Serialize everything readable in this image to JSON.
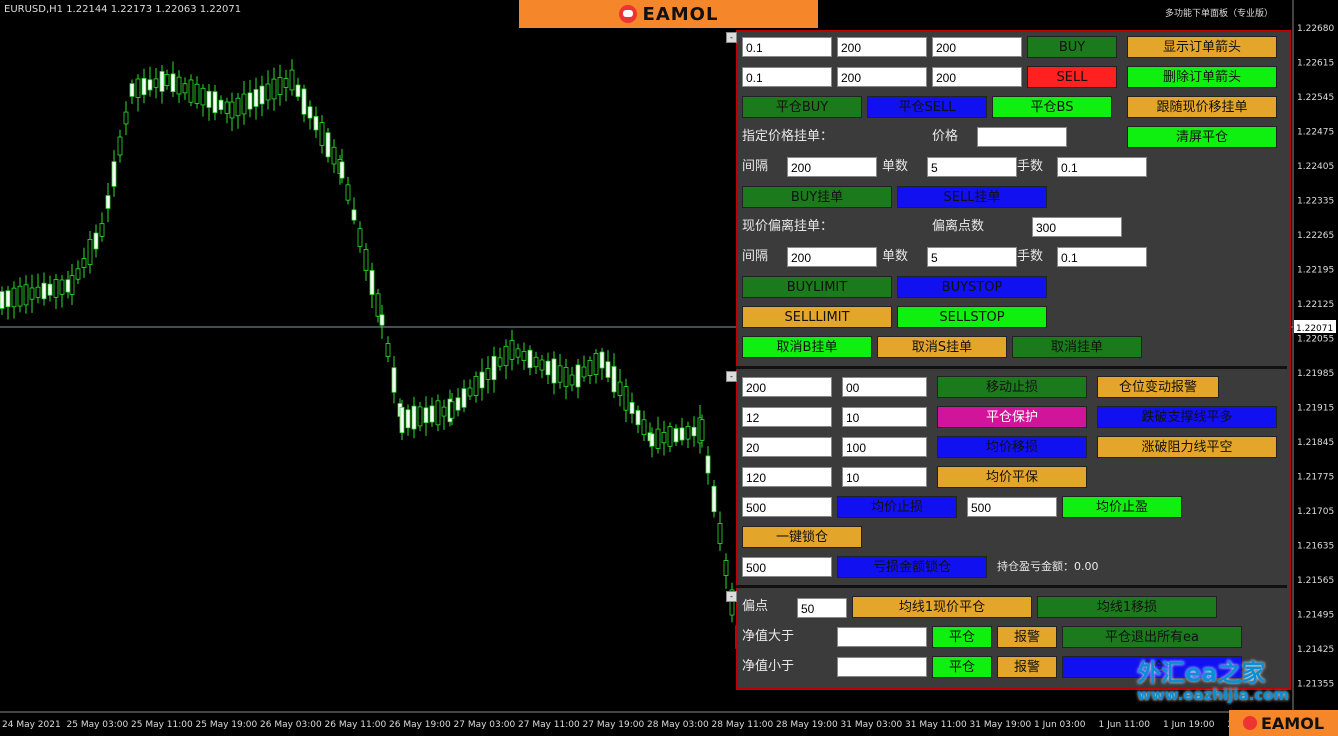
{
  "header": {
    "symbol_info": "EURUSD,H1  1.22144 1.22173 1.22063 1.22071",
    "top_right": "多功能下单面板（专业版）"
  },
  "brand": {
    "name": "EAMOL"
  },
  "price_axis": [
    "1.22680",
    "1.22615",
    "1.22545",
    "1.22475",
    "1.22405",
    "1.22335",
    "1.22265",
    "1.22195",
    "1.22125",
    "1.22071",
    "1.22055",
    "1.21985",
    "1.21915",
    "1.21845",
    "1.21775",
    "1.21705",
    "1.21635",
    "1.21565",
    "1.21495",
    "1.21425",
    "1.21355"
  ],
  "time_axis": [
    "24 May 2021",
    "25 May 03:00",
    "25 May 11:00",
    "25 May 19:00",
    "26 May 03:00",
    "26 May 11:00",
    "26 May 19:00",
    "27 May 03:00",
    "27 May 11:00",
    "27 May 19:00",
    "28 May 03:00",
    "28 May 11:00",
    "28 May 19:00",
    "31 May 03:00",
    "31 May 11:00",
    "31 May 19:00",
    "1 Jun 03:00",
    "1 Jun 11:00",
    "1 Jun 19:00",
    "2"
  ],
  "current_price": "1.22071",
  "panel": {
    "row1": {
      "lots": "0.1",
      "sl": "200",
      "tp": "200",
      "buy": "BUY",
      "show_arrows": "显示订单箭头"
    },
    "row2": {
      "lots": "0.1",
      "sl": "200",
      "tp": "200",
      "sell": "SELL",
      "delete_arrows": "删除订单箭头"
    },
    "row3": {
      "close_buy": "平仓BUY",
      "close_sell": "平仓SELL",
      "close_bs": "平仓BS",
      "follow_pending": "跟随现价移挂单"
    },
    "row4": {
      "label": "指定价格挂单：",
      "price_label": "价格",
      "price_value": "",
      "clear_close": "清屏平仓"
    },
    "row5": {
      "interval_label": "间隔",
      "interval": "200",
      "count_label": "单数",
      "count": "5",
      "lots_label": "手数",
      "lots": "0.1"
    },
    "row6": {
      "buy_pending": "BUY挂单",
      "sell_pending": "SELL挂单"
    },
    "row7": {
      "label": "现价偏离挂单：",
      "offset_label": "偏离点数",
      "offset": "300"
    },
    "row8": {
      "interval_label": "间隔",
      "interval": "200",
      "count_label": "单数",
      "count": "5",
      "lots_label": "手数",
      "lots": "0.1"
    },
    "row9": {
      "buylimit": "BUYLIMIT",
      "buystop": "BUYSTOP"
    },
    "row10": {
      "selllimit": "SELLLIMIT",
      "sellstop": "SELLSTOP"
    },
    "row11": {
      "cancel_b": "取消B挂单",
      "cancel_s": "取消S挂单",
      "cancel_all": "取消挂单"
    },
    "row12": {
      "v1": "200",
      "v2": "00",
      "move_sl": "移动止损",
      "alert": "仓位变动报警"
    },
    "row13": {
      "v1": "12",
      "v2": "10",
      "protect": "平仓保护",
      "break_support": "跌破支撑线平多"
    },
    "row14": {
      "v1": "20",
      "v2": "100",
      "avg_move": "均价移损",
      "break_resist": "涨破阻力线平空"
    },
    "row15": {
      "v1": "120",
      "v2": "10",
      "avg_be": "均价平保"
    },
    "row16": {
      "v1": "500",
      "avg_sl": "均价止损",
      "v2": "500",
      "avg_tp": "均价止盈"
    },
    "row17": {
      "lock": "一键锁仓"
    },
    "row18": {
      "v1": "500",
      "loss_lock": "亏损金额锁仓",
      "pnl_label": "持仓盈亏金额：0.00"
    },
    "row19": {
      "label": "偏点",
      "value": "50",
      "ma1_close": "均线1现价平仓",
      "ma1_move": "均线1移损"
    },
    "row20": {
      "label": "净值大于",
      "value": "",
      "close": "平仓",
      "alert": "报警",
      "close_exit": "平仓退出所有ea"
    },
    "row21": {
      "label": "净值小于",
      "value": "",
      "close": "平仓",
      "alert": "报警",
      "close2": "平仓"
    }
  },
  "watermark": {
    "title": "外汇ea之家",
    "url": "www.eazhijia.com"
  },
  "colors": {
    "dark_green": "#1b7a1b",
    "red": "#ff2020",
    "orange": "#e4a62a",
    "bright_green": "#10f010",
    "blue": "#1010f0",
    "magenta": "#d0159a"
  }
}
